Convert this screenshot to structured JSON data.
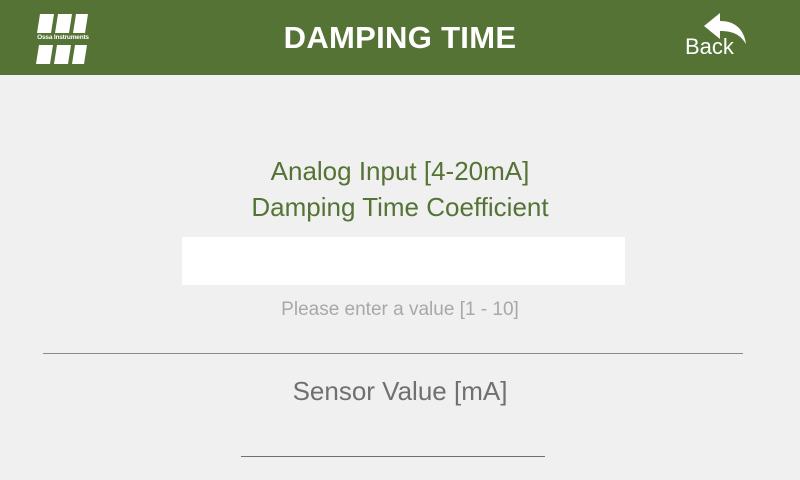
{
  "header": {
    "logo_text": "Ossa Instruments",
    "title": "DAMPING TIME",
    "back_label": "Back",
    "back_icon": "undo-arrow-icon",
    "logo_icon": "company-logo-icon"
  },
  "form": {
    "prompt_line1": "Analog Input [4-20mA]",
    "prompt_line2": "Damping Time Coefficient",
    "input_value": "",
    "hint": "Please enter a value [1 - 10]"
  },
  "sensor": {
    "label": "Sensor Value [mA]",
    "value": ""
  },
  "colors": {
    "header_bg": "#547335",
    "accent": "#547335",
    "background": "#f0f0f0",
    "hint": "#a8a8a8"
  }
}
